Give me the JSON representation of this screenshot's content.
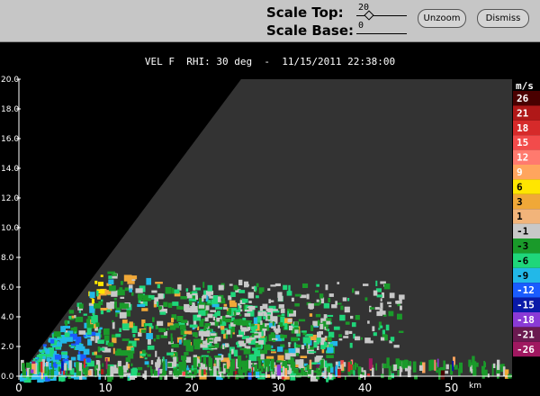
{
  "controls": {
    "scale_top_label": "Scale Top:",
    "scale_top_value": "20",
    "scale_top_level": 0.18,
    "scale_base_label": "Scale Base:",
    "scale_base_value": "0",
    "scale_base_level": 0.0,
    "unzoom_label": "Unzoom",
    "dismiss_label": "Dismiss"
  },
  "plot": {
    "title": "VEL F  RHI: 30 deg  -  11/15/2011 22:38:00",
    "x_unit": "km",
    "x_ticks": [
      "0",
      "10",
      "20",
      "30",
      "40",
      "50"
    ],
    "y_ticks": [
      "0.0",
      "2.0",
      "4.0",
      "6.0",
      "8.0",
      "10.0",
      "12.0",
      "14.0",
      "16.0",
      "18.0",
      "20.0"
    ],
    "x_range": [
      0,
      57
    ],
    "y_range": [
      0,
      20
    ],
    "background_color": "#333333",
    "blocked_color": "#000000"
  },
  "colorbar": {
    "unit": "m/s",
    "entries": [
      {
        "label": "26",
        "color": "#4a0000",
        "text": "#ffffff"
      },
      {
        "label": "21",
        "color": "#b01818",
        "text": "#ffffff"
      },
      {
        "label": "18",
        "color": "#d62a2a",
        "text": "#ffffff"
      },
      {
        "label": "15",
        "color": "#f24b4b",
        "text": "#ffffff"
      },
      {
        "label": "12",
        "color": "#ff7a6e",
        "text": "#ffffff"
      },
      {
        "label": "9",
        "color": "#ffa55e",
        "text": "#ffffff"
      },
      {
        "label": "6",
        "color": "#ffe600",
        "text": "#000000"
      },
      {
        "label": "3",
        "color": "#f0a838",
        "text": "#000000"
      },
      {
        "label": "1",
        "color": "#f2b47a",
        "text": "#000000"
      },
      {
        "label": "-1",
        "color": "#c8c8c8",
        "text": "#000000"
      },
      {
        "label": "-3",
        "color": "#1a9a2a",
        "text": "#000000"
      },
      {
        "label": "-6",
        "color": "#1fd67a",
        "text": "#000000"
      },
      {
        "label": "-9",
        "color": "#22b8e8",
        "text": "#000000"
      },
      {
        "label": "-12",
        "color": "#1a5cff",
        "text": "#ffffff"
      },
      {
        "label": "-15",
        "color": "#0a1aa8",
        "text": "#ffffff"
      },
      {
        "label": "-18",
        "color": "#8a3ad6",
        "text": "#ffffff"
      },
      {
        "label": "-21",
        "color": "#6a1a50",
        "text": "#ffffff"
      },
      {
        "label": "-26",
        "color": "#a01860",
        "text": "#ffffff"
      }
    ]
  }
}
